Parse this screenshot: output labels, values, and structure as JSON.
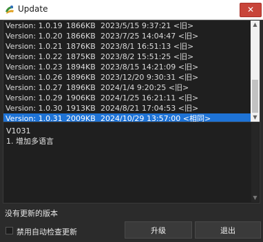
{
  "window": {
    "title": "Update",
    "close_label": "✕"
  },
  "versions": [
    {
      "version": "Version: 1.0.19",
      "size": "1866KB",
      "date": "2023/5/15 9:37:21 <旧>"
    },
    {
      "version": "Version: 1.0.20",
      "size": "1866KB",
      "date": "2023/7/25 14:04:47 <旧>"
    },
    {
      "version": "Version: 1.0.21",
      "size": "1876KB",
      "date": "2023/8/1 16:51:13 <旧>"
    },
    {
      "version": "Version: 1.0.22",
      "size": "1875KB",
      "date": "2023/8/2 15:51:25 <旧>"
    },
    {
      "version": "Version: 1.0.23",
      "size": "1894KB",
      "date": "2023/8/15 14:21:09 <旧>"
    },
    {
      "version": "Version: 1.0.26",
      "size": "1896KB",
      "date": "2023/12/20 9:30:31 <旧>"
    },
    {
      "version": "Version: 1.0.27",
      "size": "1896KB",
      "date": "2024/1/4 9:20:25 <旧>"
    },
    {
      "version": "Version: 1.0.29",
      "size": "1906KB",
      "date": "2024/1/25 16:21:11 <旧>"
    },
    {
      "version": "Version: 1.0.30",
      "size": "1913KB",
      "date": "2024/8/21 17:04:53 <旧>"
    },
    {
      "version": "Version: 1.0.31",
      "size": "2009KB",
      "date": "2024/10/29 13:57:00 <相同>"
    }
  ],
  "selected_index": 9,
  "notes": {
    "title": "V1031",
    "line1": "1. 增加多语言"
  },
  "status": "没有更新的版本",
  "auto_check_label": "禁用自动检查更新",
  "auto_check_checked": false,
  "buttons": {
    "upgrade": "升级",
    "exit": "退出"
  },
  "colors": {
    "selection": "#1e73d6",
    "background": "#1f1f1f",
    "close": "#c8453a"
  },
  "icons": {
    "app": "update-app-icon",
    "close": "close-icon",
    "scroll_up": "chevron-up-icon",
    "scroll_down": "chevron-down-icon"
  }
}
